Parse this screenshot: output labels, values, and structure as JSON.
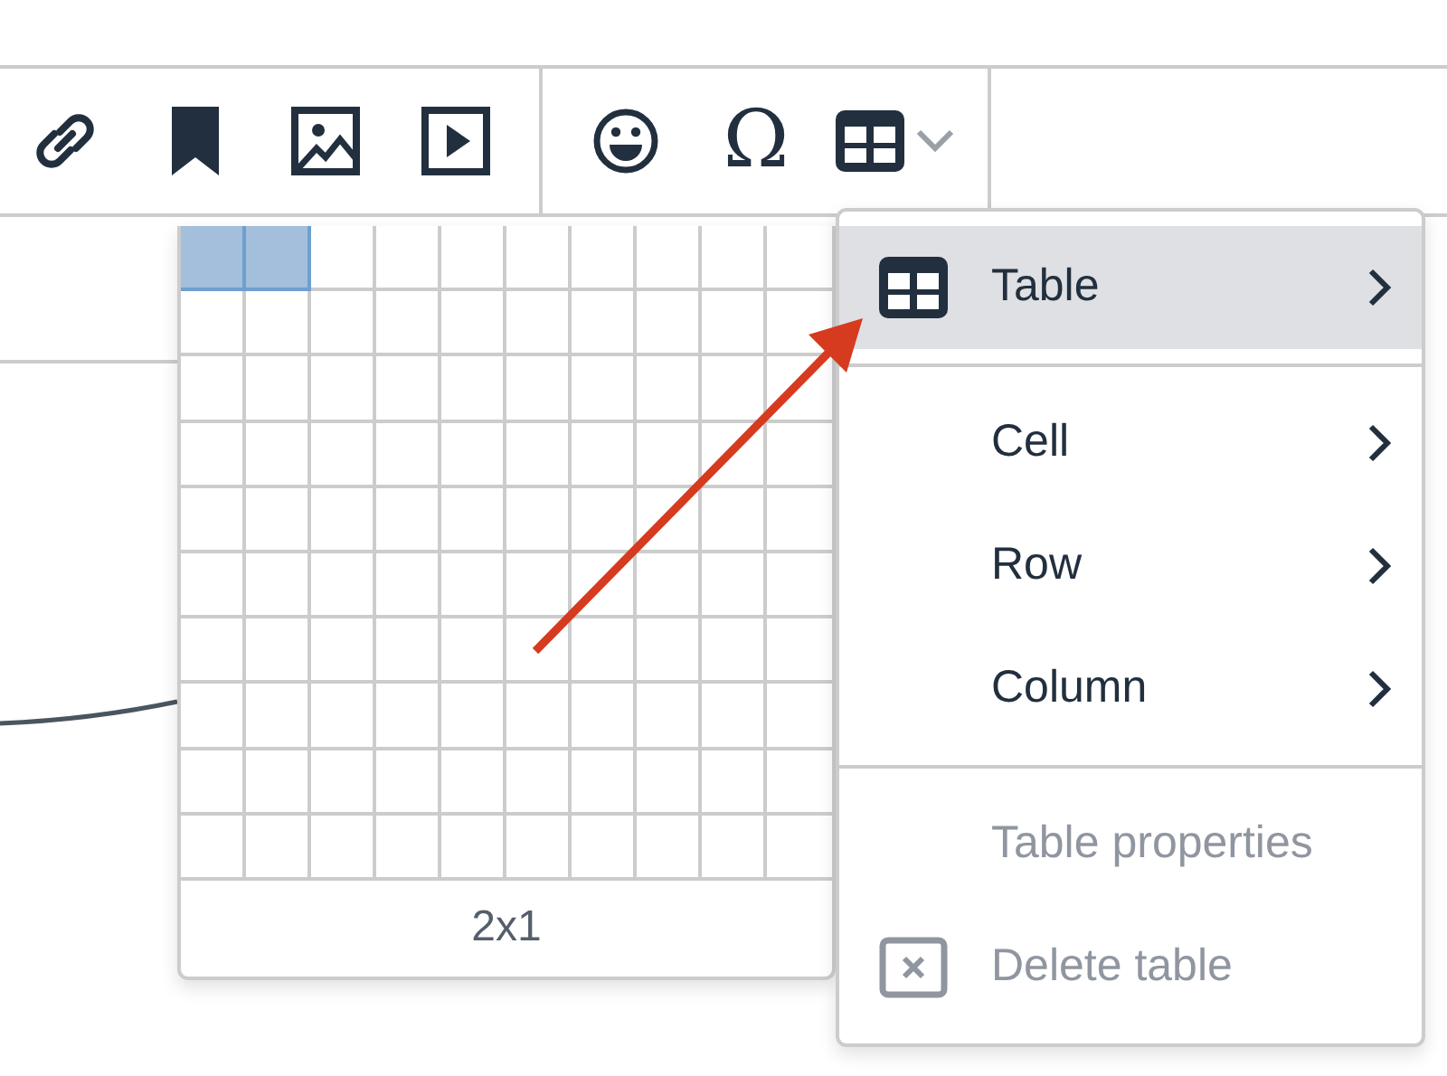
{
  "toolbar": {
    "groups": [
      {
        "items": [
          {
            "kind": "link"
          },
          {
            "kind": "bookmark"
          },
          {
            "kind": "image"
          },
          {
            "kind": "media"
          }
        ]
      },
      {
        "items": [
          {
            "kind": "emoji"
          },
          {
            "kind": "char",
            "label": "Ω"
          },
          {
            "kind": "table",
            "dropdown": true
          }
        ]
      }
    ]
  },
  "table_grid": {
    "rows": [
      {
        "cells": [
          {
            "selected": true
          },
          {
            "selected": true
          },
          {
            "selected": false
          },
          {
            "selected": false
          },
          {
            "selected": false
          },
          {
            "selected": false
          },
          {
            "selected": false
          },
          {
            "selected": false
          },
          {
            "selected": false
          },
          {
            "selected": false
          }
        ]
      },
      {
        "cells": [
          {
            "selected": false
          },
          {
            "selected": false
          },
          {
            "selected": false
          },
          {
            "selected": false
          },
          {
            "selected": false
          },
          {
            "selected": false
          },
          {
            "selected": false
          },
          {
            "selected": false
          },
          {
            "selected": false
          },
          {
            "selected": false
          }
        ]
      },
      {
        "cells": [
          {
            "selected": false
          },
          {
            "selected": false
          },
          {
            "selected": false
          },
          {
            "selected": false
          },
          {
            "selected": false
          },
          {
            "selected": false
          },
          {
            "selected": false
          },
          {
            "selected": false
          },
          {
            "selected": false
          },
          {
            "selected": false
          }
        ]
      },
      {
        "cells": [
          {
            "selected": false
          },
          {
            "selected": false
          },
          {
            "selected": false
          },
          {
            "selected": false
          },
          {
            "selected": false
          },
          {
            "selected": false
          },
          {
            "selected": false
          },
          {
            "selected": false
          },
          {
            "selected": false
          },
          {
            "selected": false
          }
        ]
      },
      {
        "cells": [
          {
            "selected": false
          },
          {
            "selected": false
          },
          {
            "selected": false
          },
          {
            "selected": false
          },
          {
            "selected": false
          },
          {
            "selected": false
          },
          {
            "selected": false
          },
          {
            "selected": false
          },
          {
            "selected": false
          },
          {
            "selected": false
          }
        ]
      },
      {
        "cells": [
          {
            "selected": false
          },
          {
            "selected": false
          },
          {
            "selected": false
          },
          {
            "selected": false
          },
          {
            "selected": false
          },
          {
            "selected": false
          },
          {
            "selected": false
          },
          {
            "selected": false
          },
          {
            "selected": false
          },
          {
            "selected": false
          }
        ]
      },
      {
        "cells": [
          {
            "selected": false
          },
          {
            "selected": false
          },
          {
            "selected": false
          },
          {
            "selected": false
          },
          {
            "selected": false
          },
          {
            "selected": false
          },
          {
            "selected": false
          },
          {
            "selected": false
          },
          {
            "selected": false
          },
          {
            "selected": false
          }
        ]
      },
      {
        "cells": [
          {
            "selected": false
          },
          {
            "selected": false
          },
          {
            "selected": false
          },
          {
            "selected": false
          },
          {
            "selected": false
          },
          {
            "selected": false
          },
          {
            "selected": false
          },
          {
            "selected": false
          },
          {
            "selected": false
          },
          {
            "selected": false
          }
        ]
      },
      {
        "cells": [
          {
            "selected": false
          },
          {
            "selected": false
          },
          {
            "selected": false
          },
          {
            "selected": false
          },
          {
            "selected": false
          },
          {
            "selected": false
          },
          {
            "selected": false
          },
          {
            "selected": false
          },
          {
            "selected": false
          },
          {
            "selected": false
          }
        ]
      },
      {
        "cells": [
          {
            "selected": false
          },
          {
            "selected": false
          },
          {
            "selected": false
          },
          {
            "selected": false
          },
          {
            "selected": false
          },
          {
            "selected": false
          },
          {
            "selected": false
          },
          {
            "selected": false
          },
          {
            "selected": false
          },
          {
            "selected": false
          }
        ]
      }
    ],
    "size_label": "2x1"
  },
  "menu": {
    "sections": [
      {
        "items": [
          {
            "label": "Table",
            "kind": "table",
            "submenu": true,
            "selected": true,
            "disabled": false
          }
        ]
      },
      {
        "items": [
          {
            "label": "Cell",
            "submenu": true,
            "selected": false,
            "disabled": false
          },
          {
            "label": "Row",
            "submenu": true,
            "selected": false,
            "disabled": false
          },
          {
            "label": "Column",
            "submenu": true,
            "selected": false,
            "disabled": false
          }
        ]
      },
      {
        "items": [
          {
            "label": "Table properties",
            "submenu": false,
            "selected": false,
            "disabled": true
          },
          {
            "label": "Delete table",
            "kind": "delete",
            "submenu": false,
            "selected": false,
            "disabled": true
          }
        ]
      }
    ]
  }
}
